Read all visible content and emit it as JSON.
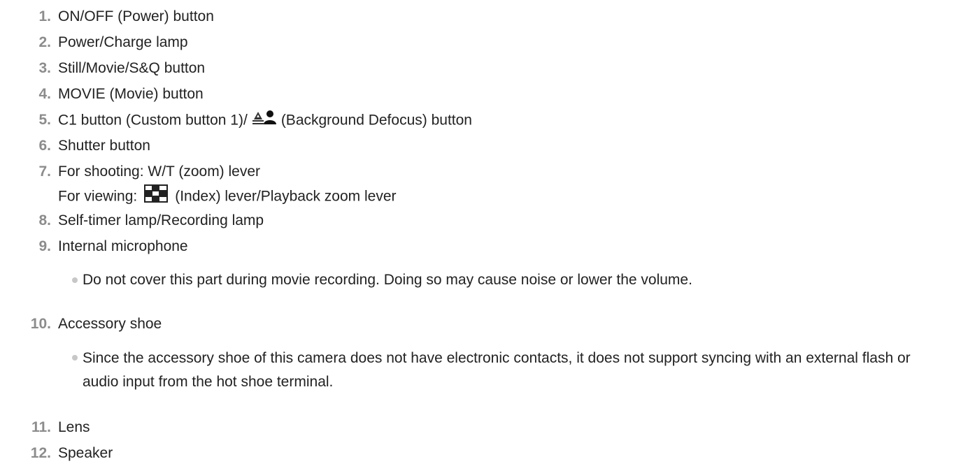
{
  "items": [
    {
      "number": "1.",
      "label": "ON/OFF (Power) button"
    },
    {
      "number": "2.",
      "label": "Power/Charge lamp"
    },
    {
      "number": "3.",
      "label": "Still/Movie/S&Q button"
    },
    {
      "number": "4.",
      "label": "MOVIE (Movie) button"
    },
    {
      "number": "5.",
      "label_before": "C1 button (Custom button 1)/",
      "icon": "background-defocus-icon",
      "label_after": "(Background Defocus) button"
    },
    {
      "number": "6.",
      "label": "Shutter button"
    },
    {
      "number": "7.",
      "label": "For shooting: W/T (zoom) lever",
      "line2_before": "For viewing:",
      "line2_icon": "index-icon",
      "line2_after": "(Index) lever/Playback zoom lever"
    },
    {
      "number": "8.",
      "label": "Self-timer lamp/Recording lamp"
    },
    {
      "number": "9.",
      "label": "Internal microphone",
      "note": "Do not cover this part during movie recording. Doing so may cause noise or lower the volume."
    },
    {
      "number": "10.",
      "label": "Accessory shoe",
      "note": "Since the accessory shoe of this camera does not have electronic contacts, it does not support syncing with an external flash or audio input from the hot shoe terminal."
    },
    {
      "number": "11.",
      "label": "Lens"
    },
    {
      "number": "12.",
      "label": "Speaker"
    }
  ],
  "colors": {
    "number": "#8c8c8c",
    "text": "#222222",
    "bullet": "#c7c7c7"
  }
}
